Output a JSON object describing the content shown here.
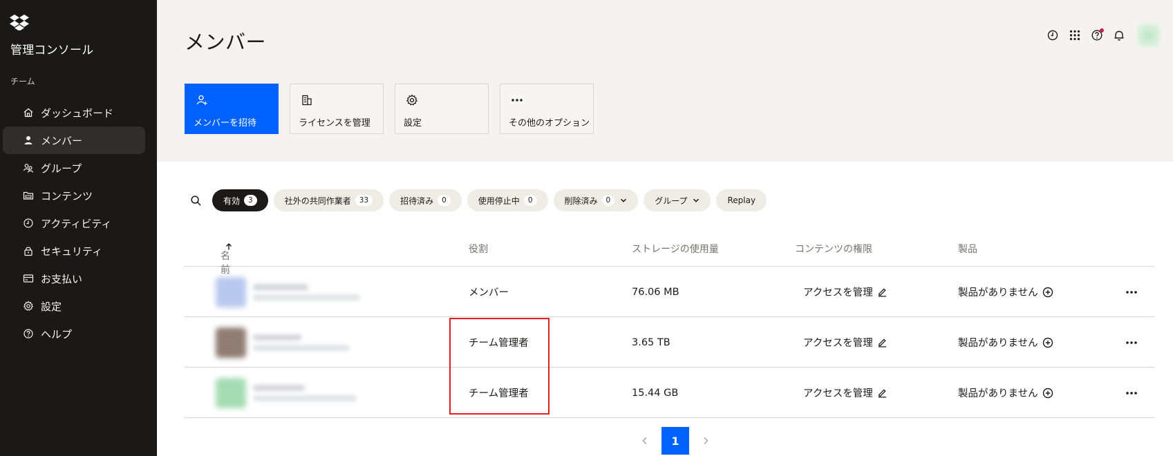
{
  "sidebar": {
    "console_title": "管理コンソール",
    "section_label": "チーム",
    "items": [
      {
        "label": "ダッシュボード",
        "icon": "home-icon"
      },
      {
        "label": "メンバー",
        "icon": "person-icon",
        "active": true
      },
      {
        "label": "グループ",
        "icon": "group-icon"
      },
      {
        "label": "コンテンツ",
        "icon": "folder-icon"
      },
      {
        "label": "アクティビティ",
        "icon": "clock-icon"
      },
      {
        "label": "セキュリティ",
        "icon": "lock-icon"
      },
      {
        "label": "お支払い",
        "icon": "card-icon"
      },
      {
        "label": "設定",
        "icon": "gear-icon"
      },
      {
        "label": "ヘルプ",
        "icon": "help-icon"
      }
    ]
  },
  "header": {
    "title": "メンバー",
    "actions": [
      {
        "label": "メンバーを招待",
        "icon": "add-person-icon"
      },
      {
        "label": "ライセンスを管理",
        "icon": "building-icon"
      },
      {
        "label": "設定",
        "icon": "gear-icon"
      },
      {
        "label": "その他のオプション",
        "icon": "more-icon"
      }
    ]
  },
  "filters": {
    "chips": [
      {
        "label": "有効",
        "count": "3",
        "active": true
      },
      {
        "label": "社外の共同作業者",
        "count": "33"
      },
      {
        "label": "招待済み",
        "count": "0"
      },
      {
        "label": "使用停止中",
        "count": "0"
      },
      {
        "label": "削除済み",
        "count": "0",
        "dropdown": true
      },
      {
        "label": "グループ",
        "dropdown": true
      },
      {
        "label": "Replay"
      }
    ]
  },
  "table": {
    "columns": {
      "name": "名前",
      "role": "役割",
      "storage": "ストレージの使用量",
      "content": "コンテンツの権限",
      "product": "製品"
    },
    "rows": [
      {
        "role": "メンバー",
        "storage": "76.06 MB",
        "content": "アクセスを管理",
        "product": "製品がありません",
        "avatar_color": "#b9c8ee"
      },
      {
        "role": "チーム管理者",
        "storage": "3.65 TB",
        "content": "アクセスを管理",
        "product": "製品がありません",
        "avatar_color": "#8f7c72"
      },
      {
        "role": "チーム管理者",
        "storage": "15.44 GB",
        "content": "アクセスを管理",
        "product": "製品がありません",
        "avatar_color": "#a6dcb4"
      }
    ]
  },
  "pagination": {
    "current_page": "1"
  },
  "colors": {
    "accent": "#0061fe",
    "sidebar_bg": "#1a1918",
    "header_bg": "#f5f3f0",
    "highlight": "#e02020"
  }
}
